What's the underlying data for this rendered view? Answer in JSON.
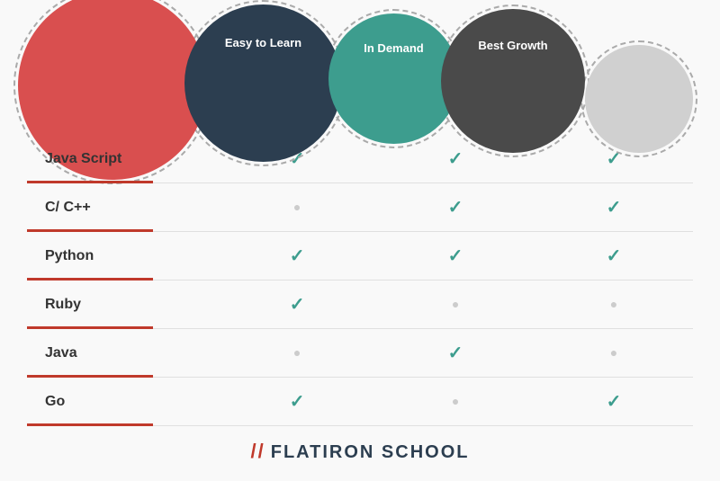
{
  "header": {
    "circles": [
      {
        "id": "lang",
        "label": "",
        "color": "#d94f4f"
      },
      {
        "id": "easy",
        "label": "Easy to Learn",
        "color": "#2c3e50"
      },
      {
        "id": "indemand",
        "label": "In Demand",
        "color": "#3d9d8e"
      },
      {
        "id": "growth",
        "label": "Best Growth",
        "color": "#4a4a4a"
      },
      {
        "id": "extra",
        "label": "",
        "color": "#d0d0d0"
      }
    ]
  },
  "columns": [
    {
      "id": "easy",
      "label": "Easy to Learn"
    },
    {
      "id": "indemand",
      "label": "In Demand"
    },
    {
      "id": "growth",
      "label": "Best Growth"
    }
  ],
  "rows": [
    {
      "lang": "Java Script",
      "easy": true,
      "indemand": true,
      "growth": true
    },
    {
      "lang": "C/ C++",
      "easy": false,
      "indemand": true,
      "growth": true
    },
    {
      "lang": "Python",
      "easy": true,
      "indemand": true,
      "growth": true
    },
    {
      "lang": "Ruby",
      "easy": true,
      "indemand": false,
      "growth": false
    },
    {
      "lang": "Java",
      "easy": false,
      "indemand": true,
      "growth": false
    },
    {
      "lang": "Go",
      "easy": true,
      "indemand": false,
      "growth": true
    }
  ],
  "footer": {
    "slashes": "//",
    "brand": "FLATIRON SCHOOL"
  }
}
